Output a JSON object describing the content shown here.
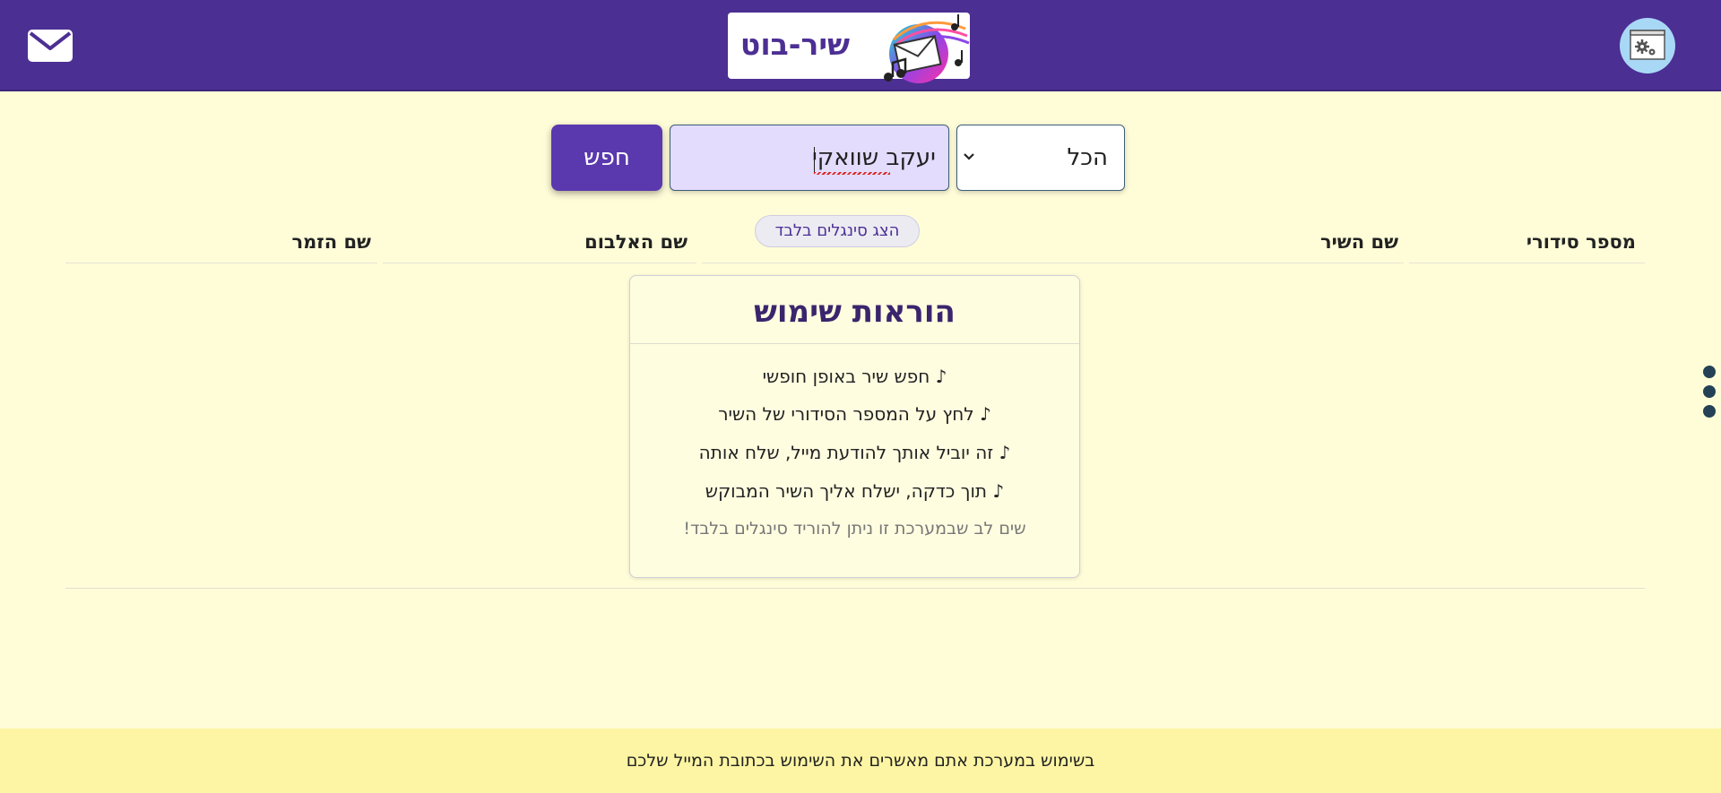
{
  "header": {
    "logo_text": "שיר-בוט",
    "mail_icon": "envelope-icon",
    "settings_icon": "gear-settings-icon"
  },
  "search": {
    "button_label": "חפש",
    "input_value": "יעקב שוואקי",
    "category_value": "הכל"
  },
  "singles_toggle_label": "הצג סינגלים בלבד",
  "table": {
    "columns": [
      "מספר סידורי",
      "שם השיר",
      "שם האלבום",
      "שם הזמר"
    ]
  },
  "instructions": {
    "title": "הוראות שימוש",
    "lines": [
      "♪ חפש שיר באופן חופשי",
      "♪ לחץ על המספר הסידורי של השיר",
      "♪ זה יוביל אותך להודעת מייל, שלח אותה",
      "♪ תוך כדקה, ישלח אליך השיר המבוקש"
    ],
    "note": "שים לב שבמערכת זו ניתן להוריד סינגלים בלבד!"
  },
  "footer": {
    "text": "בשימוש במערכת אתם מאשרים את השימוש בכתובת המייל שלכם"
  },
  "colors": {
    "header_bg": "#4c2f93",
    "page_bg": "#fffdd8",
    "accent_button": "#5a38ad",
    "input_bg": "#e3dcfc",
    "footer_bg": "#fdf5a3"
  }
}
